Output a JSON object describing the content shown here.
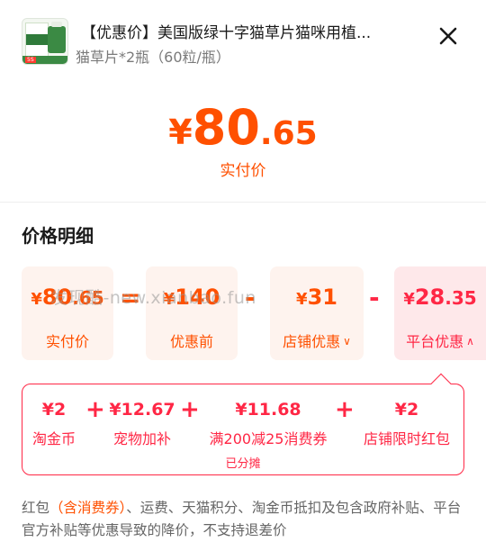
{
  "header": {
    "title": "【优惠价】美国版绿十字猫草片猫咪用植...",
    "subtitle": "猫草片*2瓶（60粒/瓶）",
    "close_icon": "close-icon",
    "thumbnail": {
      "tag": "5S"
    }
  },
  "summary": {
    "currency": "¥",
    "integer": "80",
    "decimal": ".65",
    "label": "实付价"
  },
  "details": {
    "title": "价格明细",
    "cards": [
      {
        "currency": "¥",
        "integer": "80",
        "decimal": ".65",
        "label": "实付价"
      },
      {
        "currency": "¥",
        "integer": "140",
        "decimal": "",
        "label": "优惠前"
      },
      {
        "currency": "¥",
        "integer": "31",
        "decimal": "",
        "label": "店铺优惠"
      },
      {
        "currency": "¥",
        "integer": "28",
        "decimal": ".35",
        "label": "平台优惠"
      }
    ],
    "operators": [
      "=",
      "-",
      "-"
    ]
  },
  "watermark": "发现酷-new.xianbao.fun",
  "breakdown": {
    "items": [
      {
        "amount": "¥2",
        "label": "淘金币"
      },
      {
        "amount": "¥12.67",
        "label": "宠物加补"
      },
      {
        "amount": "¥11.68",
        "label": "满200减25消费券"
      },
      {
        "amount": "¥2",
        "label": "店铺限时红包"
      }
    ],
    "operators": [
      "+",
      "+",
      "+"
    ],
    "note": "已分摊"
  },
  "footnote": {
    "before": "红包",
    "highlight": "（含消费券）",
    "after": "、运费、天猫积分、淘金币抵扣及包含政府补贴、平台官方补贴等优惠导致的降价，不支持退差价"
  },
  "colors": {
    "accent": "#ff5000",
    "platform": "#ff2745",
    "card_bg": "#fef3ee",
    "platform_card_bg": "#fee8ea"
  }
}
